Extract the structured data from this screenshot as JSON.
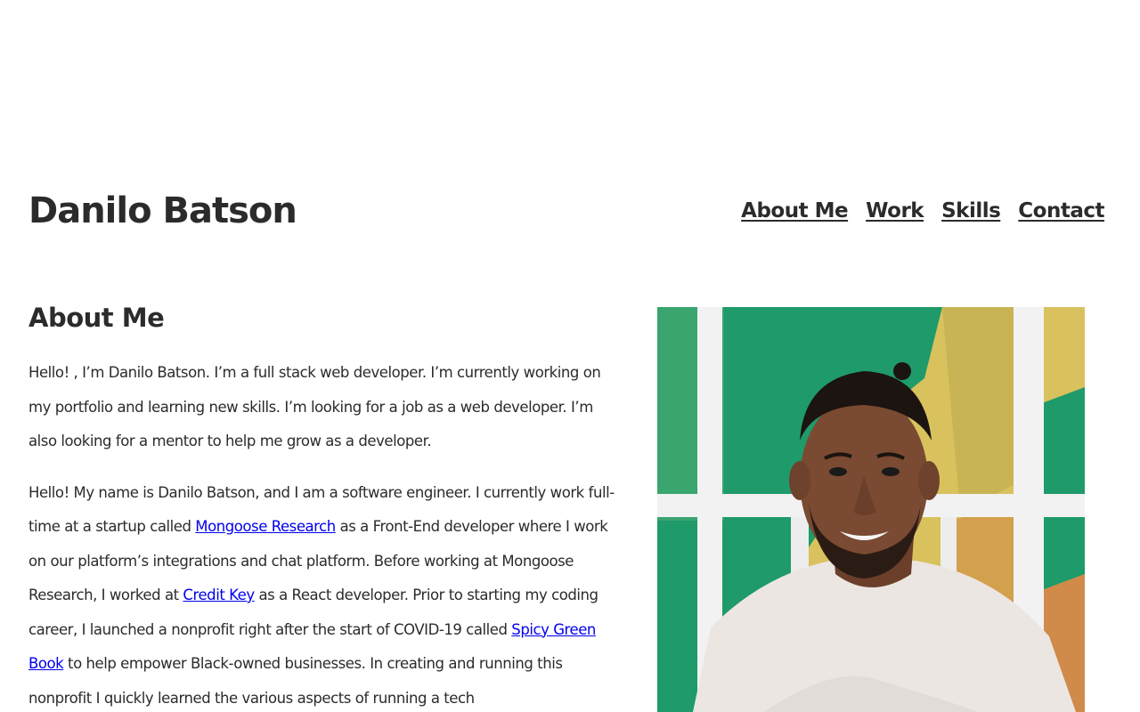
{
  "header": {
    "site_title": "Danilo Batson",
    "nav": [
      {
        "label": "About Me"
      },
      {
        "label": "Work"
      },
      {
        "label": "Skills"
      },
      {
        "label": "Contact"
      }
    ]
  },
  "about": {
    "heading": "About Me",
    "paragraph1": "Hello! , I’m Danilo Batson. I’m a full stack web developer. I’m currently working on my portfolio and learning new skills. I’m looking for a job as a web developer. I’m also looking for a mentor to help me grow as a developer.",
    "paragraph2": {
      "text1": "Hello! My name is Danilo Batson, and I am a software engineer. I currently work full-time at a startup called ",
      "link1": "Mongoose Research",
      "text2": " as a Front-End developer where I work on our platform’s integrations and chat platform. Before working at Mongoose Research, I worked at ",
      "link2": "Credit Key",
      "text3": " as a React developer. Prior to starting my coding career, I launched a nonprofit right after the start of COVID-19 called ",
      "link3": "Spicy Green Book",
      "text4": " to help empower Black-owned businesses. In creating and running this nonprofit I quickly learned the various aspects of running a tech"
    }
  },
  "photo": {
    "icon": "portrait-photo-icon",
    "colors": {
      "green": "#1f9a6a",
      "yellow": "#d9c25e",
      "orange": "#d08a4a",
      "frame": "#f2f2f2",
      "skin": "#7a4a32",
      "shirt": "#ece6e2"
    }
  }
}
